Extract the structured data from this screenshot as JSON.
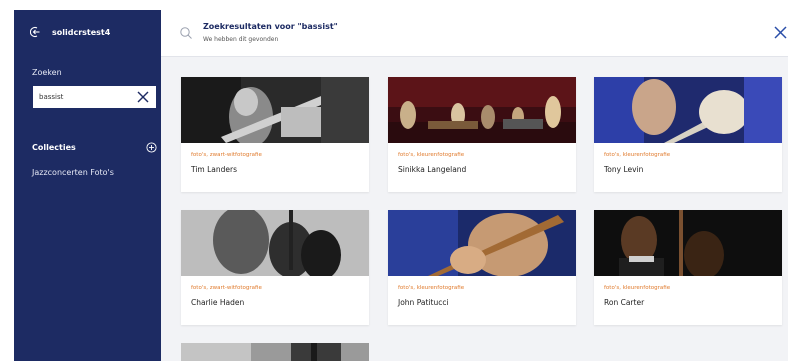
{
  "sidebar": {
    "username": "solidcrstest4",
    "search_label": "Zoeken",
    "search_value": "bassist",
    "collections_label": "Collecties",
    "collections": [
      "Jazzconcerten Foto's"
    ]
  },
  "header": {
    "title": "Zoekresultaten voor \"bassist\"",
    "subtitle": "We hebben dit gevonden"
  },
  "results": [
    {
      "category": "foto's, zwart-witfotografie",
      "name": "Tim Landers"
    },
    {
      "category": "foto's, kleurenfotografie",
      "name": "Sinikka Langeland"
    },
    {
      "category": "foto's, kleurenfotografie",
      "name": "Tony Levin"
    },
    {
      "category": "foto's, zwart-witfotografie",
      "name": "Charlie Haden"
    },
    {
      "category": "foto's, kleurenfotografie",
      "name": "John Patitucci"
    },
    {
      "category": "foto's, kleurenfotografie",
      "name": "Ron Carter"
    }
  ],
  "colors": {
    "sidebar_bg": "#1d2b63",
    "accent_orange": "#e07a2c",
    "content_bg": "#f2f3f6"
  },
  "icons": {
    "logout": "logout-icon",
    "clear_search": "close-icon",
    "add_collection": "plus-circle-icon",
    "search": "search-icon",
    "close_results": "close-icon"
  }
}
